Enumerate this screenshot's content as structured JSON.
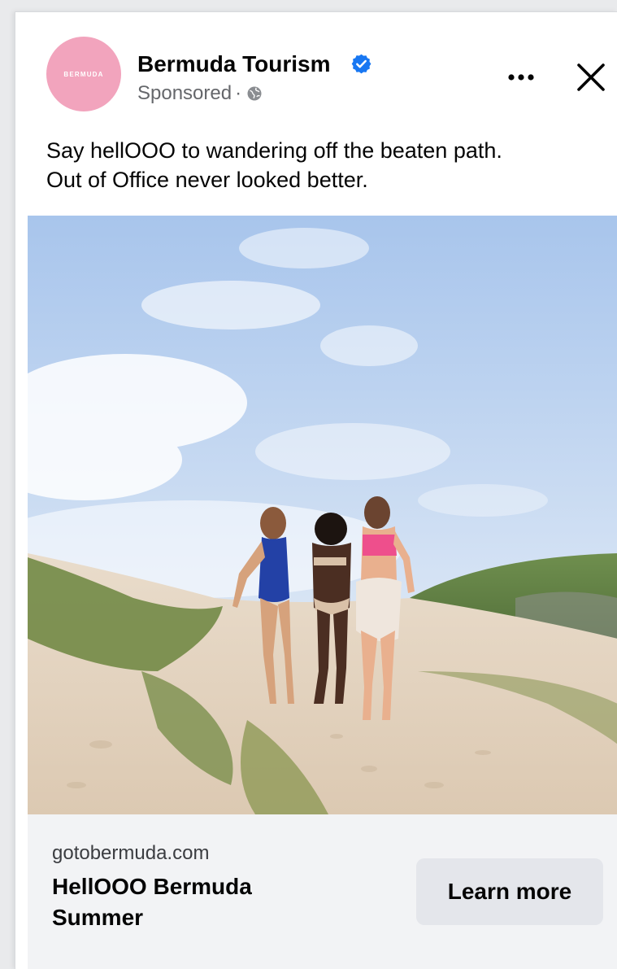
{
  "ad": {
    "page_name": "Bermuda Tourism",
    "avatar_text": "BERMUDA",
    "sponsored_label": "Sponsored",
    "separator": "·",
    "caption": [
      "Say hellOOO to wandering off the beaten path.",
      "Out of Office never looked better."
    ]
  },
  "link": {
    "domain": "gotobermuda.com",
    "headline": "HellOOO Bermuda Summer",
    "cta_label": "Learn more"
  },
  "icons": {
    "verified": "verified-badge-icon",
    "audience": "globe-icon",
    "more": "more-options-icon",
    "close": "close-icon"
  },
  "colors": {
    "avatar": "#f2a4bd",
    "verified": "#1877f2",
    "secondary_text": "#65676b",
    "cta_background": "#e4e6eb",
    "footer_background": "#f2f3f5"
  }
}
